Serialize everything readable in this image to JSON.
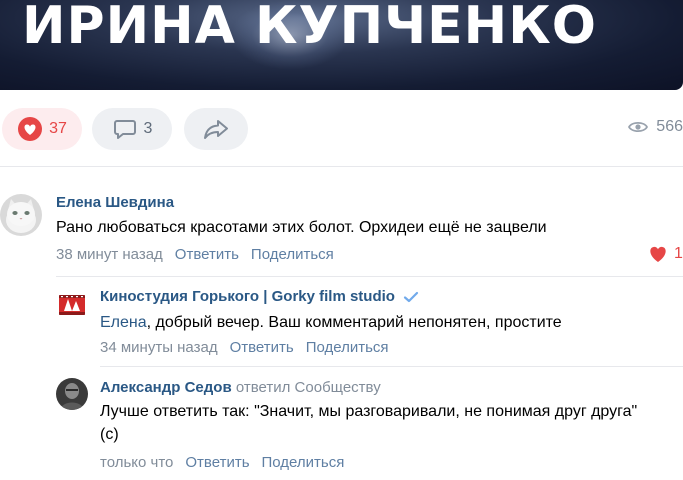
{
  "banner": {
    "title": "ИРИНА КУПЧЕНКО"
  },
  "actions": {
    "likes": "37",
    "comments": "3",
    "views": "566",
    "colors": {
      "like": "#e64646",
      "link": "#2a5885",
      "muted": "#818c99"
    }
  },
  "comments": [
    {
      "author": "Елена Шевдина",
      "text": "Рано любоваться красотами этих болот. Орхидеи ещё не зацвели",
      "time": "38 минут назад",
      "reply_label": "Ответить",
      "share_label": "Поделиться",
      "likes": "1"
    },
    {
      "author": "Киностудия Горького | Gorky film studio",
      "verified_icon": "check-icon",
      "addressee": "Елена",
      "text": ", добрый вечер. Ваш комментарий непонятен, простите",
      "time": "34 минуты назад",
      "reply_label": "Ответить",
      "share_label": "Поделиться"
    },
    {
      "author": "Александр Седов",
      "replied_to": "ответил Сообществу",
      "text": "Лучше ответить так: \"Значит, мы разговаривали, не понимая друг друга\" (с)",
      "time": "только что",
      "reply_label": "Ответить",
      "share_label": "Поделиться"
    }
  ]
}
